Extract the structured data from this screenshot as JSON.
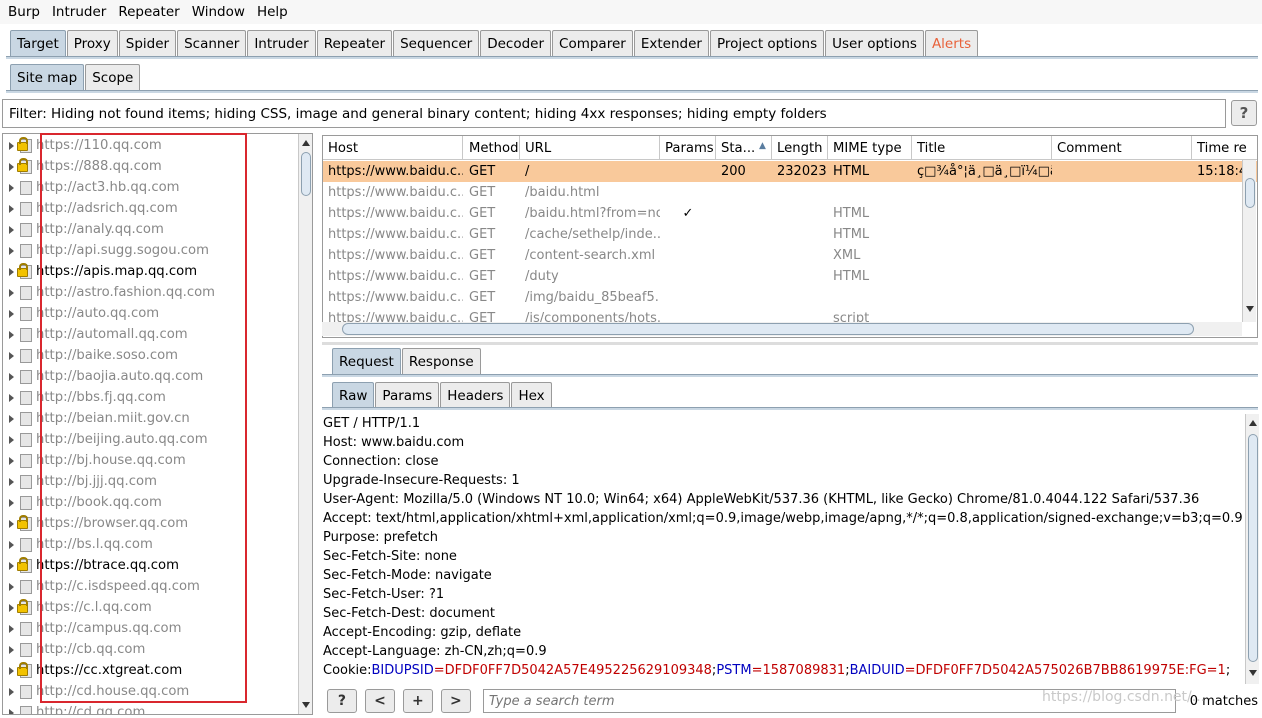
{
  "menu": [
    "Burp",
    "Intruder",
    "Repeater",
    "Window",
    "Help"
  ],
  "main_tabs": [
    {
      "label": "Target",
      "selected": true
    },
    {
      "label": "Proxy"
    },
    {
      "label": "Spider"
    },
    {
      "label": "Scanner"
    },
    {
      "label": "Intruder"
    },
    {
      "label": "Repeater"
    },
    {
      "label": "Sequencer"
    },
    {
      "label": "Decoder"
    },
    {
      "label": "Comparer"
    },
    {
      "label": "Extender"
    },
    {
      "label": "Project options"
    },
    {
      "label": "User options"
    },
    {
      "label": "Alerts",
      "alert": true
    }
  ],
  "sub_tabs": [
    {
      "label": "Site map",
      "selected": true
    },
    {
      "label": "Scope"
    }
  ],
  "filter_text": "Filter: Hiding not found items;  hiding CSS, image and general binary content;  hiding 4xx responses;  hiding empty folders",
  "help_label": "?",
  "site_tree": [
    {
      "url": "https://110.qq.com",
      "lock": true,
      "bold": false
    },
    {
      "url": "https://888.qq.com",
      "lock": true,
      "bold": false
    },
    {
      "url": "http://act3.hb.qq.com",
      "lock": false,
      "bold": false
    },
    {
      "url": "http://adsrich.qq.com",
      "lock": false,
      "bold": false
    },
    {
      "url": "http://analy.qq.com",
      "lock": false,
      "bold": false
    },
    {
      "url": "http://api.sugg.sogou.com",
      "lock": false,
      "bold": false
    },
    {
      "url": "https://apis.map.qq.com",
      "lock": true,
      "bold": true
    },
    {
      "url": "http://astro.fashion.qq.com",
      "lock": false,
      "bold": false
    },
    {
      "url": "http://auto.qq.com",
      "lock": false,
      "bold": false
    },
    {
      "url": "http://automall.qq.com",
      "lock": false,
      "bold": false
    },
    {
      "url": "http://baike.soso.com",
      "lock": false,
      "bold": false
    },
    {
      "url": "http://baojia.auto.qq.com",
      "lock": false,
      "bold": false
    },
    {
      "url": "http://bbs.fj.qq.com",
      "lock": false,
      "bold": false
    },
    {
      "url": "http://beian.miit.gov.cn",
      "lock": false,
      "bold": false
    },
    {
      "url": "http://beijing.auto.qq.com",
      "lock": false,
      "bold": false
    },
    {
      "url": "http://bj.house.qq.com",
      "lock": false,
      "bold": false
    },
    {
      "url": "http://bj.jjj.qq.com",
      "lock": false,
      "bold": false
    },
    {
      "url": "http://book.qq.com",
      "lock": false,
      "bold": false
    },
    {
      "url": "https://browser.qq.com",
      "lock": true,
      "bold": false
    },
    {
      "url": "http://bs.l.qq.com",
      "lock": false,
      "bold": false
    },
    {
      "url": "https://btrace.qq.com",
      "lock": true,
      "bold": true
    },
    {
      "url": "http://c.isdspeed.qq.com",
      "lock": false,
      "bold": false
    },
    {
      "url": "https://c.l.qq.com",
      "lock": true,
      "bold": false
    },
    {
      "url": "http://campus.qq.com",
      "lock": false,
      "bold": false
    },
    {
      "url": "http://cb.qq.com",
      "lock": false,
      "bold": false
    },
    {
      "url": "https://cc.xtgreat.com",
      "lock": true,
      "bold": true
    },
    {
      "url": "http://cd.house.qq.com",
      "lock": false,
      "bold": false
    },
    {
      "url": "http://cd.qq.com",
      "lock": false,
      "bold": false
    }
  ],
  "table": {
    "columns": [
      "Host",
      "Method",
      "URL",
      "Params",
      "Sta...",
      "Length",
      "MIME type",
      "Title",
      "Comment",
      "Time re"
    ],
    "rows": [
      {
        "host": "https://www.baidu.c...",
        "method": "GET",
        "url": "/",
        "params": "",
        "status": "200",
        "length": "232023",
        "mime": "HTML",
        "title": "ç□¾å°¦ä¸□ä¸□ï¼□ä...",
        "comment": "",
        "time": "15:18:4",
        "selected": true
      },
      {
        "host": "https://www.baidu.c...",
        "method": "GET",
        "url": "/baidu.html",
        "params": "",
        "status": "",
        "length": "",
        "mime": "",
        "title": "",
        "comment": "",
        "time": ""
      },
      {
        "host": "https://www.baidu.c...",
        "method": "GET",
        "url": "/baidu.html?from=no...",
        "params": "✓",
        "status": "",
        "length": "",
        "mime": "HTML",
        "title": "",
        "comment": "",
        "time": ""
      },
      {
        "host": "https://www.baidu.c...",
        "method": "GET",
        "url": "/cache/sethelp/inde...",
        "params": "",
        "status": "",
        "length": "",
        "mime": "HTML",
        "title": "",
        "comment": "",
        "time": ""
      },
      {
        "host": "https://www.baidu.c...",
        "method": "GET",
        "url": "/content-search.xml",
        "params": "",
        "status": "",
        "length": "",
        "mime": "XML",
        "title": "",
        "comment": "",
        "time": ""
      },
      {
        "host": "https://www.baidu.c...",
        "method": "GET",
        "url": "/duty",
        "params": "",
        "status": "",
        "length": "",
        "mime": "HTML",
        "title": "",
        "comment": "",
        "time": ""
      },
      {
        "host": "https://www.baidu.c...",
        "method": "GET",
        "url": "/img/baidu_85beaf5...",
        "params": "",
        "status": "",
        "length": "",
        "mime": "",
        "title": "",
        "comment": "",
        "time": ""
      },
      {
        "host": "https://www.baidu.c...",
        "method": "GET",
        "url": "/js/components/hots...",
        "params": "",
        "status": "",
        "length": "",
        "mime": "script",
        "title": "",
        "comment": "",
        "time": ""
      }
    ]
  },
  "req_tabs": [
    {
      "label": "Request",
      "selected": true
    },
    {
      "label": "Response"
    }
  ],
  "raw_tabs": [
    {
      "label": "Raw",
      "selected": true
    },
    {
      "label": "Params"
    },
    {
      "label": "Headers"
    },
    {
      "label": "Hex"
    }
  ],
  "raw_lines": [
    "GET / HTTP/1.1",
    "Host: www.baidu.com",
    "Connection: close",
    "Upgrade-Insecure-Requests: 1",
    "User-Agent: Mozilla/5.0 (Windows NT 10.0; Win64; x64) AppleWebKit/537.36 (KHTML, like Gecko) Chrome/81.0.4044.122 Safari/537.36",
    "Accept: text/html,application/xhtml+xml,application/xml;q=0.9,image/webp,image/apng,*/*;q=0.8,application/signed-exchange;v=b3;q=0.9",
    "Purpose: prefetch",
    "Sec-Fetch-Site: none",
    "Sec-Fetch-Mode: navigate",
    "Sec-Fetch-User: ?1",
    "Sec-Fetch-Dest: document",
    "Accept-Encoding: gzip, deflate",
    "Accept-Language: zh-CN,zh;q=0.9"
  ],
  "cookie": {
    "prefix": "Cookie: ",
    "pairs": [
      {
        "k": "BIDUPSID",
        "v": "DFDF0FF7D5042A57E495225629109348"
      },
      {
        "k": "PSTM",
        "v": "1587089831"
      },
      {
        "k": "BAIDUID",
        "v": "DFDF0FF7D5042A575026B7BB8619975E:FG=1"
      }
    ]
  },
  "bottom": {
    "help": "?",
    "prev": "<",
    "add": "+",
    "next": ">",
    "search_placeholder": "Type a search term",
    "matches": "0 matches"
  },
  "watermark": "https://blog.csdn.net/..."
}
